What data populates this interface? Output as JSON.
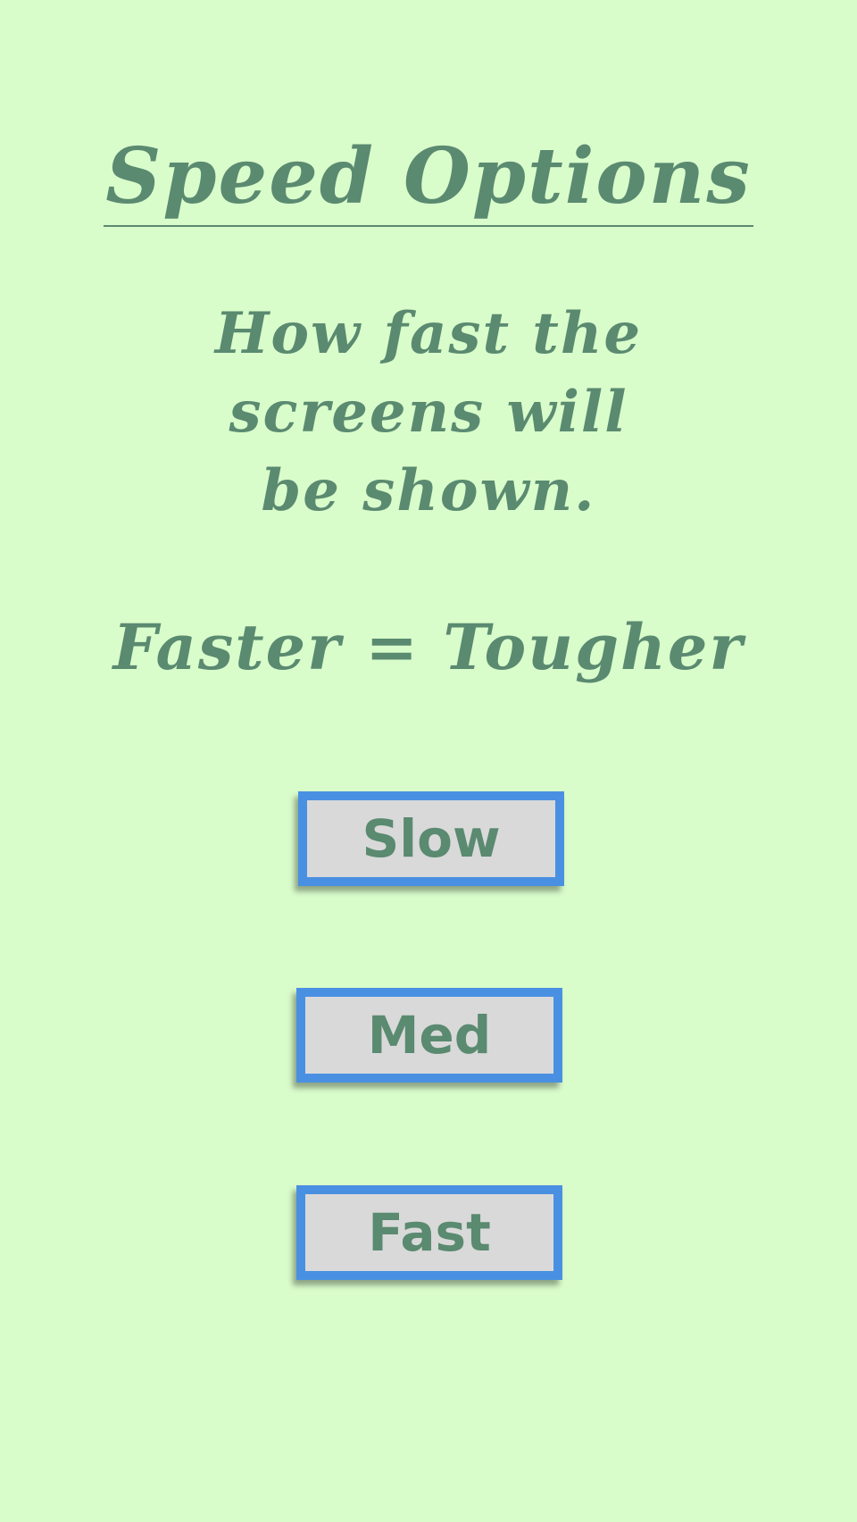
{
  "header": {
    "title": "Speed Options"
  },
  "description": {
    "lines": [
      "How fast the",
      "screens will",
      "be shown."
    ]
  },
  "note": "Faster = Tougher",
  "buttons": {
    "slow": "Slow",
    "med": "Med",
    "fast": "Fast"
  },
  "colors": {
    "background": "#d9fccb",
    "text": "#5a8a70",
    "button_border": "#4a90e2",
    "button_fill": "#d9d9d9"
  }
}
